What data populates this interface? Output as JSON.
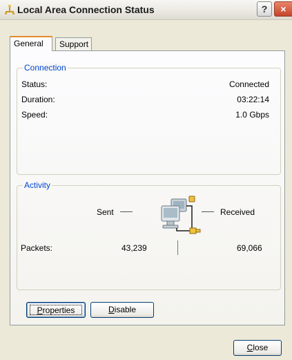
{
  "window": {
    "title": "Local Area Connection Status"
  },
  "titlebar": {
    "help_glyph": "?",
    "close_glyph": "×"
  },
  "tabs": [
    {
      "label": "General",
      "active": true
    },
    {
      "label": "Support",
      "active": false
    }
  ],
  "connection": {
    "legend": "Connection",
    "rows": [
      {
        "label": "Status:",
        "value": "Connected"
      },
      {
        "label": "Duration:",
        "value": "03:22:14"
      },
      {
        "label": "Speed:",
        "value": "1.0 Gbps"
      }
    ]
  },
  "activity": {
    "legend": "Activity",
    "sent_label": "Sent",
    "received_label": "Received",
    "packets_label": "Packets:",
    "packets_sent": "43,239",
    "packets_received": "69,066",
    "icon": "network-computers-icon"
  },
  "buttons": {
    "properties": {
      "accel": "P",
      "rest": "roperties"
    },
    "disable": {
      "accel": "D",
      "rest": "isable"
    },
    "close": {
      "accel": "C",
      "rest": "lose"
    }
  },
  "colors": {
    "legend": "#0046d5",
    "active_tab_accent": "#e68b2c",
    "window_bg": "#ece9d8"
  }
}
